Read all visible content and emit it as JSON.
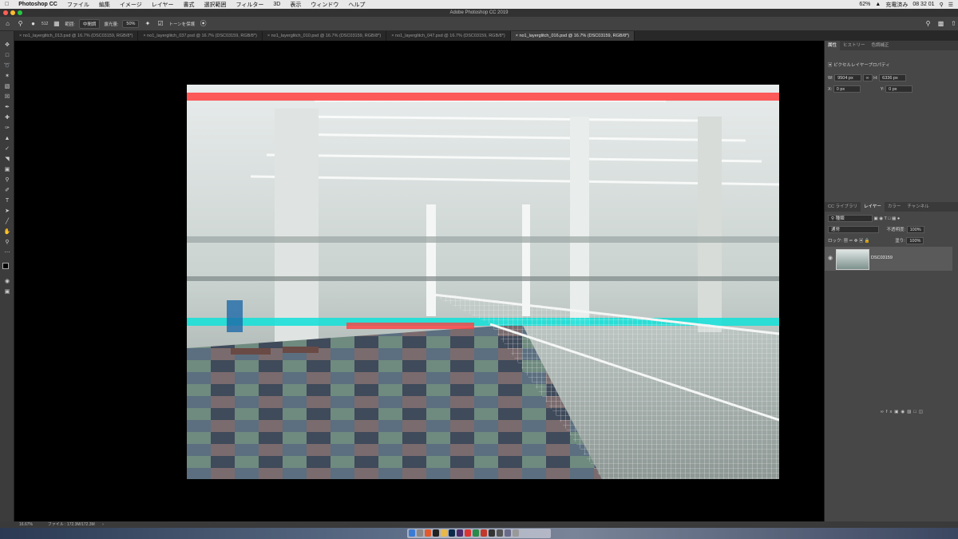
{
  "menubar": {
    "app": "Photoshop CC",
    "items": [
      "ファイル",
      "編集",
      "イメージ",
      "レイヤー",
      "書式",
      "選択範囲",
      "フィルター",
      "3D",
      "表示",
      "ウィンドウ",
      "ヘルプ"
    ],
    "battery": "62%",
    "charge": "充電済み",
    "clock": "08 32 01"
  },
  "window": {
    "title": "Adobe Photoshop CC 2019"
  },
  "options": {
    "brush_size": "512",
    "range_label": "範囲:",
    "range_value": "中間調",
    "exposure_label": "露光量:",
    "exposure_value": "50%",
    "protect_tones": "トーンを保護"
  },
  "tabs": [
    {
      "label": "no1_layerglitch_013.psd @ 16.7% (DSC03159, RGB/8*)"
    },
    {
      "label": "no1_layerglitch_037.psd @ 16.7% (DSC03159, RGB/8*)"
    },
    {
      "label": "no1_layerglitch_010.psd @ 16.7% (DSC03159, RGB/8*)"
    },
    {
      "label": "no1_layerglitch_047.psd @ 16.7% (DSC03159, RGB/8*)"
    },
    {
      "label": "no1_layerglitch_016.psd @ 16.7% (DSC03159, RGB/8*)"
    }
  ],
  "properties": {
    "tabs": [
      "属性",
      "ヒストリー",
      "色調補正"
    ],
    "subtitle": "ピクセルレイヤープロパティ",
    "w_label": "W:",
    "w": "9504 px",
    "h_label": "H:",
    "h": "6336 px",
    "x_label": "X:",
    "x": "0 px",
    "y_label": "Y:",
    "y": "0 px"
  },
  "layers": {
    "tabs": [
      "CC ライブラリ",
      "レイヤー",
      "カラー",
      "チャンネル"
    ],
    "filter": "種類",
    "blend": "通常",
    "opacity_label": "不透明度:",
    "opacity": "100%",
    "lock_label": "ロック:",
    "fill_label": "塗り:",
    "fill": "100%",
    "layer_name": "DSC03159"
  },
  "status": {
    "zoom": "16.67%",
    "file": "ファイル : 172.3M/172.3M"
  },
  "colors": {
    "accent": "#3b3b3b",
    "glitch_red": "#ff4040",
    "glitch_cyan": "#10e0d8"
  }
}
